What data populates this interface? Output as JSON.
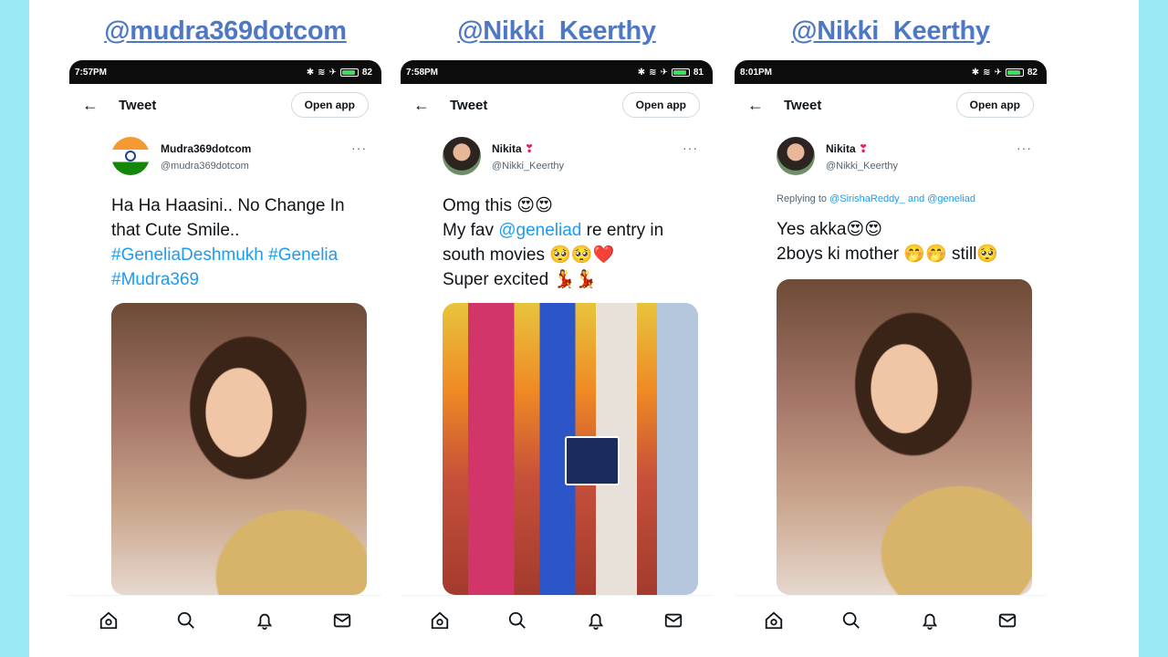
{
  "columns": [
    {
      "header_link": "@mudra369dotcom",
      "status_time": "7:57PM",
      "battery_label": "82",
      "topbar": {
        "title": "Tweet",
        "open_app": "Open app"
      },
      "author": {
        "name": "Mudra369dotcom",
        "handle": "@mudra369dotcom",
        "avatar": "india-flag"
      },
      "replying": null,
      "text_lines": [
        {
          "text": "Ha Ha Haasini.. No Change In",
          "hashtag": false
        },
        {
          "text": "that Cute Smile..",
          "hashtag": false
        },
        {
          "text": "#GeneliaDeshmukh #Genelia",
          "hashtag": true
        },
        {
          "text": "#Mudra369",
          "hashtag": true
        }
      ]
    },
    {
      "header_link": "@Nikki_Keerthy",
      "status_time": "7:58PM",
      "battery_label": "81",
      "topbar": {
        "title": "Tweet",
        "open_app": "Open app"
      },
      "author": {
        "name": "Nikita",
        "name_suffix": "❣",
        "handle": "@Nikki_Keerthy",
        "avatar": "profile-photo"
      },
      "replying": null,
      "text_lines": [
        {
          "text": "Omg this 😍😍"
        },
        {
          "text": "My fav ",
          "mention": "@geneliad",
          "after": " re entry in"
        },
        {
          "text": "south movies 🥺🥺❤️"
        },
        {
          "text": "Super excited 💃💃"
        }
      ]
    },
    {
      "header_link": "@Nikki_Keerthy",
      "status_time": "8:01PM",
      "battery_label": "82",
      "topbar": {
        "title": "Tweet",
        "open_app": "Open app"
      },
      "author": {
        "name": "Nikita",
        "name_suffix": "❣",
        "handle": "@Nikki_Keerthy",
        "avatar": "profile-photo"
      },
      "replying": {
        "prefix": "Replying to ",
        "mentions": "@SirishaReddy_ and @geneliad"
      },
      "text_lines": [
        {
          "text": "Yes akka😍😍"
        },
        {
          "text": "2boys ki mother 🤭🤭 still🥺"
        }
      ]
    }
  ],
  "nav_icons": [
    "home-icon",
    "search-icon",
    "bell-icon",
    "mail-icon"
  ],
  "colors": {
    "link_blue": "#1d9bf0",
    "header_link": "#4f78c4",
    "frame_bg": "#9be8f5"
  }
}
